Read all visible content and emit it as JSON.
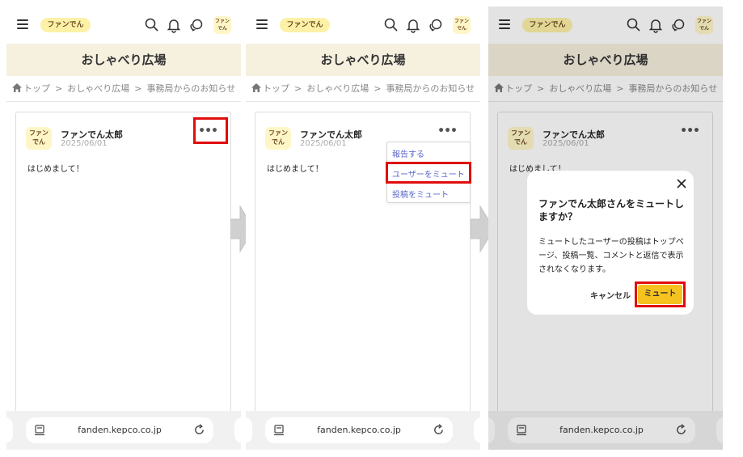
{
  "brand": {
    "logo_text": "ファンでん",
    "avatar_text_line1": "ファン",
    "avatar_text_line2": "でん"
  },
  "page_title": "おしゃべり広場",
  "breadcrumb": {
    "home": "トップ",
    "sep": ">",
    "level2": "おしゃべり広場",
    "level3": "事務局からのお知らせ"
  },
  "post": {
    "avatar_line1": "ファン",
    "avatar_line2": "でん",
    "author": "ファンでん太郎",
    "date": "2025/06/01",
    "more": "•••",
    "body": "はじめまして！"
  },
  "menu": {
    "items": [
      "報告する",
      "ユーザーをミュート",
      "投稿をミュート"
    ]
  },
  "dialog": {
    "title": "ファンでん太郎さんをミュートしますか？",
    "body": "ミュートしたユーザーの投稿はトップページ、投稿一覧、コメントと返信で表示されなくなります。",
    "cancel": "キャンセル",
    "confirm": "ミュート"
  },
  "browser": {
    "url": "fanden.kepco.co.jp"
  },
  "colors": {
    "highlight": "#e10d0d",
    "menu_link": "#5b67c9",
    "accent_button": "#f6c21f",
    "title_bg": "#f6f0df"
  }
}
